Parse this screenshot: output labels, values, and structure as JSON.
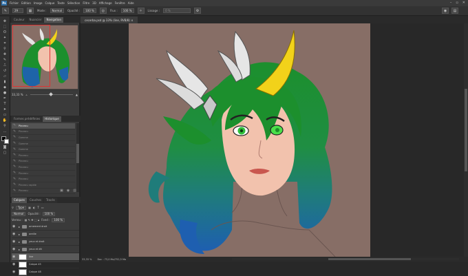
{
  "app": {
    "logo": "Ps"
  },
  "menu": [
    "Fichier",
    "Edition",
    "Image",
    "Calque",
    "Texte",
    "Sélection",
    "Filtre",
    "3D",
    "Affichage",
    "Fenêtre",
    "Aide"
  ],
  "options": {
    "mode_label": "Mode :",
    "mode_value": "Normal",
    "opacity_label": "Opacité :",
    "opacity_value": "100 %",
    "flow_label": "Flux :",
    "flow_value": "100 %",
    "smoothing_label": "Lissage :",
    "smoothing_value": "0 %",
    "brush_size": "29"
  },
  "navigator": {
    "tabs": [
      "Couleur",
      "Nuancier",
      "Navigation"
    ],
    "active_tab": "Navigation",
    "zoom": "33,33 %"
  },
  "history": {
    "tabs": [
      "Formes prédéfinies",
      "Historique"
    ],
    "active_tab": "Historique",
    "rows": [
      "Pinceau",
      "Pinceau",
      "Gomme",
      "Gomme",
      "Gomme",
      "Pinceau",
      "Pinceau",
      "Pinceau",
      "Pinceau",
      "Pinceau",
      "Pinceau rapide",
      "Pinceau"
    ],
    "selected_index": 0
  },
  "layers": {
    "tabs": [
      "Calques",
      "Couches",
      "Tracés"
    ],
    "active_tab": "Calques",
    "kind_label": "Type",
    "blend_mode": "Normal",
    "opacity_label": "Opacité :",
    "opacity_value": "100 %",
    "lock_label": "Verrou :",
    "fill_label": "Fond :",
    "fill_value": "100 %",
    "items": [
      {
        "name": "ornement droit",
        "type": "folder",
        "selected": false
      },
      {
        "name": "oreille",
        "type": "folder",
        "selected": false
      },
      {
        "name": "yeux et droit",
        "type": "folder",
        "selected": false
      },
      {
        "name": "yeux et dit",
        "type": "folder",
        "selected": false
      },
      {
        "name": "line",
        "type": "layer",
        "selected": true
      },
      {
        "name": "Calque 45",
        "type": "layer",
        "selected": false
      },
      {
        "name": "Calque 48",
        "type": "layer",
        "selected": false
      }
    ]
  },
  "document": {
    "tab_title": "cecerba.psd @ 33% (line, RVB/8)",
    "close": "×"
  },
  "status": {
    "zoom": "33,33 %",
    "doc_info": "Doc : 73,0 Mo/752,5 Mo"
  },
  "colors": {
    "canvas_bg": "#876e66",
    "hair_green": "#1c8f2d",
    "hair_blue": "#1e64a8",
    "horn_yellow": "#f2d21a",
    "skin": "#f2c2ad"
  }
}
